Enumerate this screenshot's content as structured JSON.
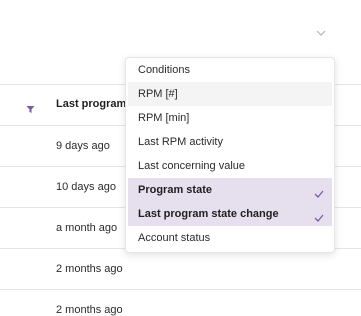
{
  "table": {
    "column_header": "Last program",
    "rows": [
      {
        "value": "9 days ago"
      },
      {
        "value": "10 days ago"
      },
      {
        "value": "a month ago"
      },
      {
        "value": "2 months ago"
      },
      {
        "value": "2 months ago"
      }
    ]
  },
  "column_menu": {
    "items": [
      {
        "label": "Conditions",
        "selected": false
      },
      {
        "label": "RPM [#]",
        "selected": false
      },
      {
        "label": "RPM [min]",
        "selected": false
      },
      {
        "label": "Last RPM activity",
        "selected": false
      },
      {
        "label": "Last concerning value",
        "selected": false
      },
      {
        "label": "Program state",
        "selected": true
      },
      {
        "label": "Last program state change",
        "selected": true
      },
      {
        "label": "Account status",
        "selected": false
      }
    ]
  },
  "icons": {
    "top": "chevron-down-icon",
    "filter": "filter-icon",
    "check": "check-icon"
  },
  "colors": {
    "accent": "#7a5bb0",
    "selected_bg": "#e6e0ee",
    "hover_bg": "#f4f4f5"
  }
}
